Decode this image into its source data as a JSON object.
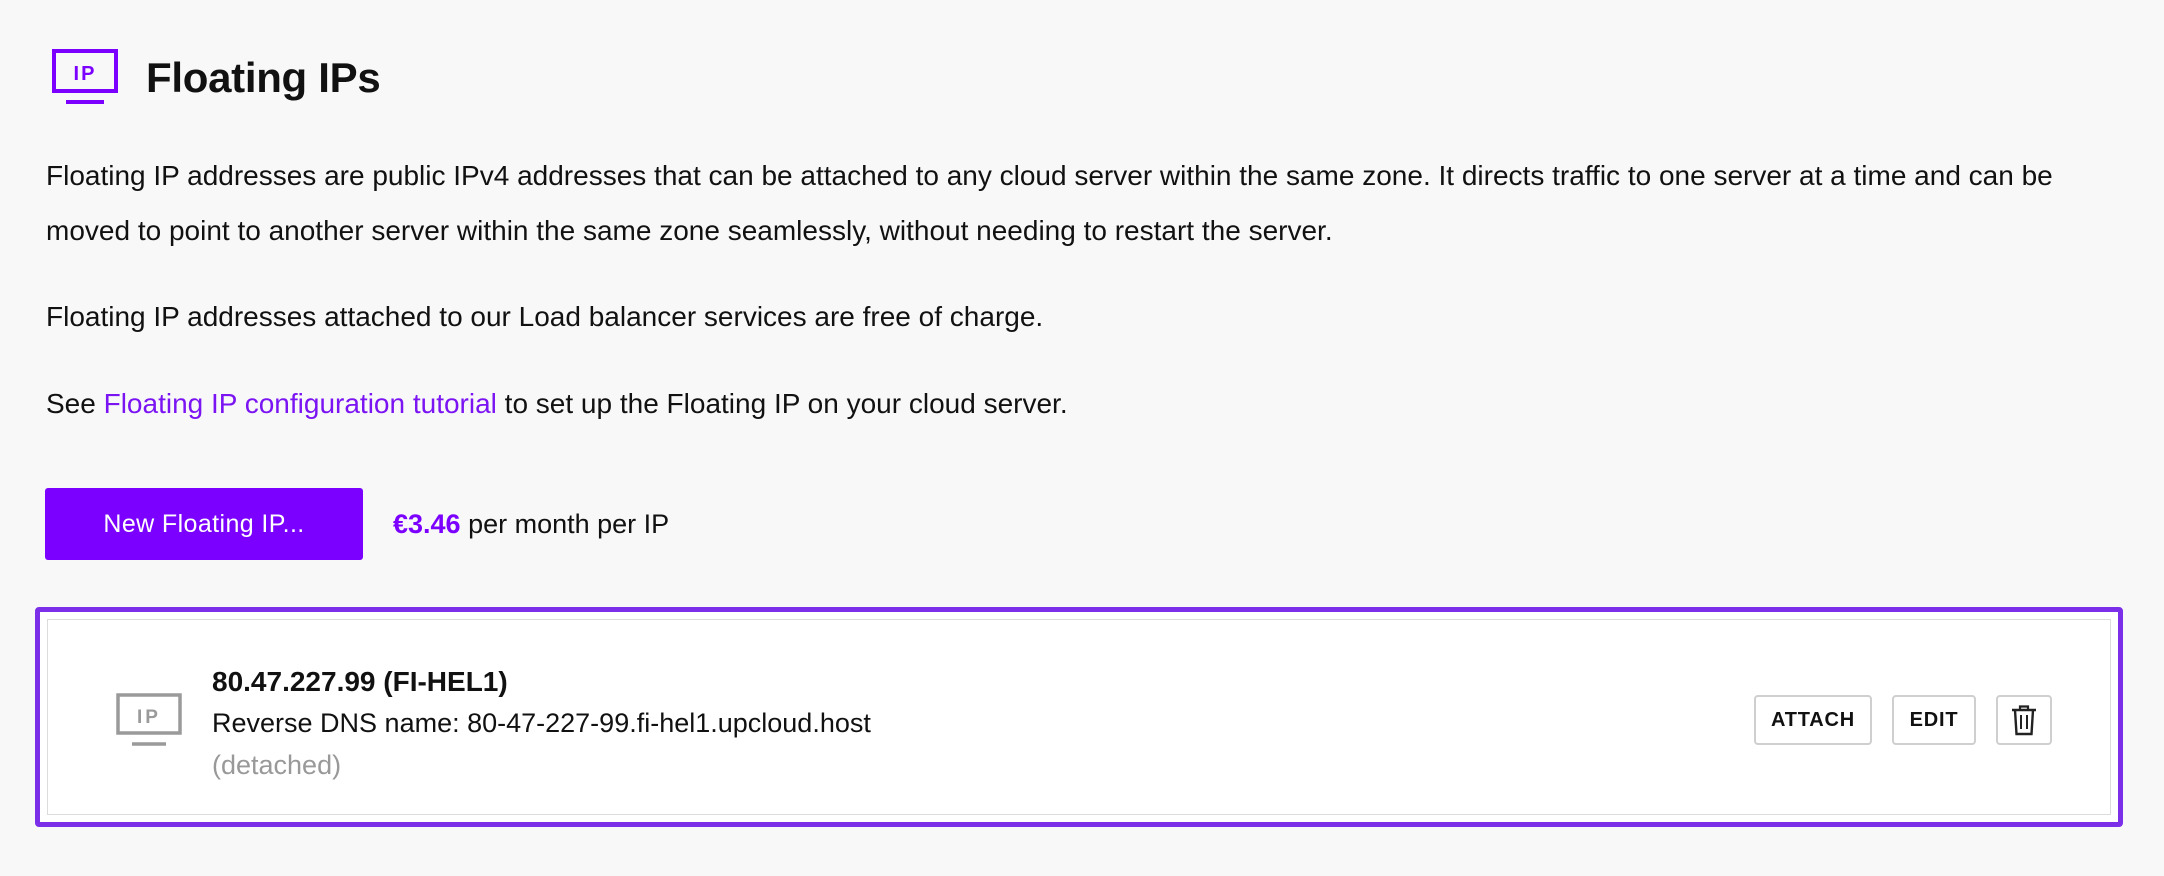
{
  "header": {
    "icon": "ip-icon",
    "icon_label": "IP",
    "title": "Floating IPs"
  },
  "description": {
    "paragraph1": "Floating IP addresses are public IPv4 addresses that can be attached to any cloud server within the same zone. It directs traffic to one server at a time and can be moved to point to another server within the same zone seamlessly, without needing to restart the server.",
    "paragraph2": "Floating IP addresses attached to our Load balancer services are free of charge.",
    "paragraph3_prefix": "See ",
    "tutorial_link": "Floating IP configuration tutorial",
    "paragraph3_suffix": " to set up the Floating IP on your cloud server."
  },
  "actions": {
    "new_button_label": "New Floating IP...",
    "price_amount": "€3.46",
    "price_suffix": " per month per IP"
  },
  "floating_ips": [
    {
      "icon_label": "IP",
      "title": "80.47.227.99 (FI-HEL1)",
      "reverse_dns": "Reverse DNS name: 80-47-227-99.fi-hel1.upcloud.host",
      "status": "(detached)",
      "attach_label": "ATTACH",
      "edit_label": "EDIT",
      "delete_icon": "trash-icon"
    }
  ],
  "colors": {
    "accent": "#7b00ff",
    "link": "#7b14f2",
    "card_border": "#7b2fe8",
    "muted": "#999999",
    "background": "#f8f8f8"
  }
}
